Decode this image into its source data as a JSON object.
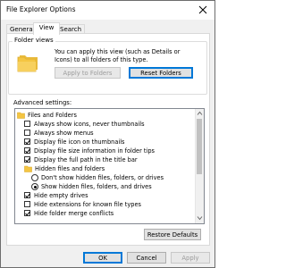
{
  "window": {
    "title": "File Explorer Options"
  },
  "tabs": [
    {
      "label": "General",
      "active": false
    },
    {
      "label": "View",
      "active": true
    },
    {
      "label": "Search",
      "active": false
    }
  ],
  "folder_views": {
    "label": "Folder views",
    "description": "You can apply this view (such as Details or Icons) to all folders of this type.",
    "apply_button": "Apply to Folders",
    "reset_button": "Reset Folders"
  },
  "advanced": {
    "label": "Advanced settings:",
    "items": [
      {
        "type": "folder",
        "label": "Files and Folders",
        "indent": 0
      },
      {
        "type": "checkbox",
        "label": "Always show icons, never thumbnails",
        "checked": false,
        "indent": 1
      },
      {
        "type": "checkbox",
        "label": "Always show menus",
        "checked": false,
        "indent": 1
      },
      {
        "type": "checkbox",
        "label": "Display file icon on thumbnails",
        "checked": true,
        "indent": 1
      },
      {
        "type": "checkbox",
        "label": "Display file size information in folder tips",
        "checked": true,
        "indent": 1
      },
      {
        "type": "checkbox",
        "label": "Display the full path in the title bar",
        "checked": true,
        "indent": 1
      },
      {
        "type": "folder",
        "label": "Hidden files and folders",
        "indent": 1
      },
      {
        "type": "radio",
        "label": "Don't show hidden files, folders, or drives",
        "checked": false,
        "indent": 2
      },
      {
        "type": "radio",
        "label": "Show hidden files, folders, and drives",
        "checked": true,
        "indent": 2
      },
      {
        "type": "checkbox",
        "label": "Hide empty drives",
        "checked": true,
        "indent": 1
      },
      {
        "type": "checkbox",
        "label": "Hide extensions for known file types",
        "checked": false,
        "indent": 1
      },
      {
        "type": "checkbox",
        "label": "Hide folder merge conflicts",
        "checked": true,
        "indent": 1
      }
    ]
  },
  "restore_button": "Restore Defaults",
  "footer": {
    "ok": "OK",
    "cancel": "Cancel",
    "apply": "Apply"
  },
  "colors": {
    "accent": "#0078d7",
    "folder": "#f4c542"
  },
  "icons": {
    "close": "close-icon",
    "folder": "folder-icon",
    "checkbox": "checkbox",
    "radio": "radio"
  }
}
